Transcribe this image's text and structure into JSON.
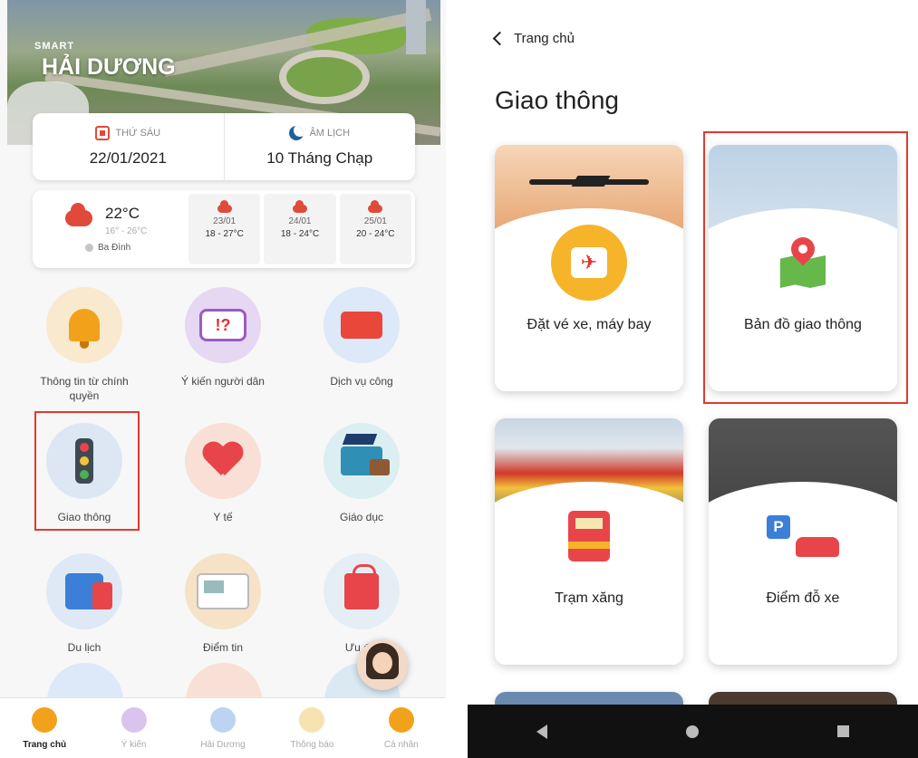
{
  "left": {
    "brand": {
      "small": "SMART",
      "big": "HẢI DƯƠNG"
    },
    "date": {
      "solar_label": "THỨ SÁU",
      "solar_value": "22/01/2021",
      "lunar_label": "ÂM LỊCH",
      "lunar_value": "10 Tháng Chạp"
    },
    "weather": {
      "today_temp": "22°C",
      "today_range": "16° - 26°C",
      "location": "Ba Đình",
      "forecast": [
        {
          "date": "23/01",
          "range": "18 - 27°C"
        },
        {
          "date": "24/01",
          "range": "18 - 24°C"
        },
        {
          "date": "25/01",
          "range": "20 - 24°C"
        }
      ]
    },
    "tiles": [
      {
        "label": "Thông tin từ chính quyền",
        "icon": "bell-icon"
      },
      {
        "label": "Ý kiến người dân",
        "icon": "feedback-icon"
      },
      {
        "label": "Dịch vụ công",
        "icon": "public-service-icon"
      },
      {
        "label": "Giao thông",
        "icon": "traffic-light-icon"
      },
      {
        "label": "Y tế",
        "icon": "health-icon"
      },
      {
        "label": "Giáo dục",
        "icon": "education-icon"
      },
      {
        "label": "Du lịch",
        "icon": "travel-icon"
      },
      {
        "label": "Điểm tin",
        "icon": "news-icon"
      },
      {
        "label": "Ưu đãi",
        "icon": "deals-icon"
      }
    ],
    "nav": [
      {
        "label": "Trang chủ",
        "color": "#f2a21a"
      },
      {
        "label": "Ý kiến",
        "color": "#9a5bc8"
      },
      {
        "label": "Hải Dương",
        "color": "#3b7fd6"
      },
      {
        "label": "Thông báo",
        "color": "#f2c23a"
      },
      {
        "label": "Cá nhân",
        "color": "#e8454a"
      }
    ]
  },
  "right": {
    "back_label": "Trang chủ",
    "title": "Giao thông",
    "cards": [
      {
        "label": "Đặt vé xe, máy bay",
        "icon": "airplane-ticket-icon"
      },
      {
        "label": "Bản đồ giao thông",
        "icon": "traffic-map-icon"
      },
      {
        "label": "Trạm xăng",
        "icon": "gas-pump-icon"
      },
      {
        "label": "Điểm đỗ xe",
        "icon": "parking-icon"
      }
    ]
  },
  "colors": {
    "highlight": "#e03a2e",
    "accent_red": "#e8454a",
    "accent_orange": "#f2a21a"
  }
}
